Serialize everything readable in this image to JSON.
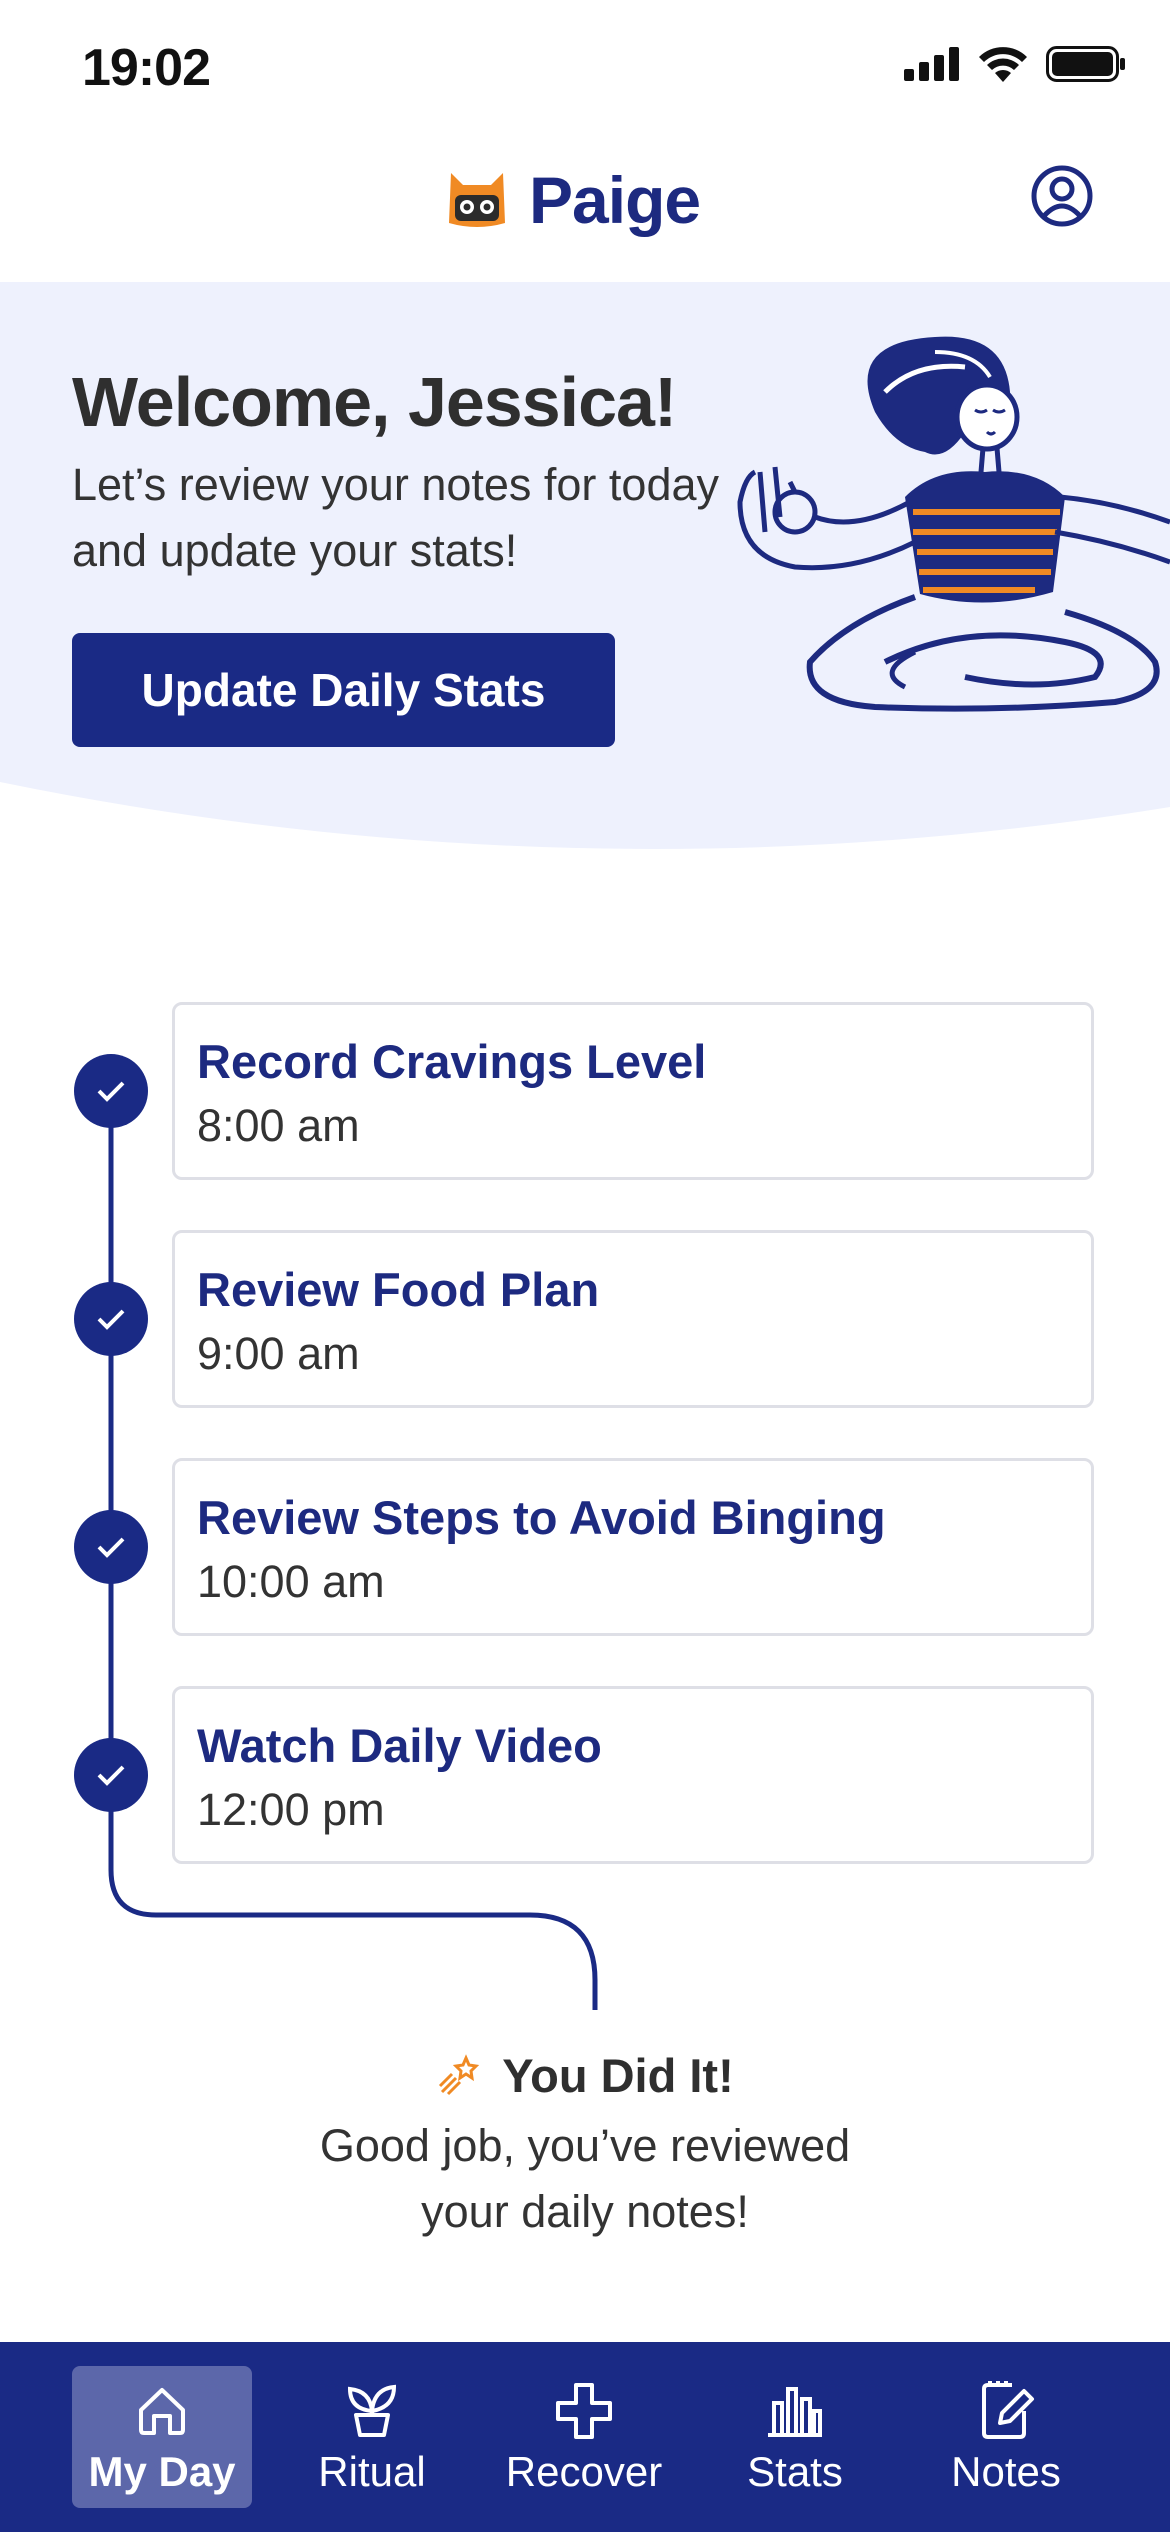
{
  "status_bar": {
    "time": "19:02"
  },
  "header": {
    "app_name": "Paige"
  },
  "hero": {
    "title": "Welcome, Jessica!",
    "subtitle": "Let’s review your notes for today and update your stats!",
    "cta_label": "Update Daily Stats"
  },
  "tasks": [
    {
      "title": "Record Cravings Level",
      "time": "8:00 am",
      "completed": true
    },
    {
      "title": "Review Food Plan",
      "time": "9:00 am",
      "completed": true
    },
    {
      "title": "Review Steps to Avoid Binging",
      "time": "10:00 am",
      "completed": true
    },
    {
      "title": "Watch Daily Video",
      "time": "12:00 pm",
      "completed": true
    }
  ],
  "completion": {
    "title": "You Did It!",
    "message": "Good job, you’ve reviewed your daily notes!"
  },
  "nav": {
    "items": [
      {
        "label": "My Day",
        "icon": "home-icon",
        "active": true
      },
      {
        "label": "Ritual",
        "icon": "sprout-icon",
        "active": false
      },
      {
        "label": "Recover",
        "icon": "plus-cross-icon",
        "active": false
      },
      {
        "label": "Stats",
        "icon": "bar-chart-icon",
        "active": false
      },
      {
        "label": "Notes",
        "icon": "note-edit-icon",
        "active": false
      }
    ]
  },
  "colors": {
    "primary": "#1a2a85",
    "hero_background": "#eef1fd",
    "accent_orange": "#f08a24",
    "nav_active": "#5c67aa"
  }
}
